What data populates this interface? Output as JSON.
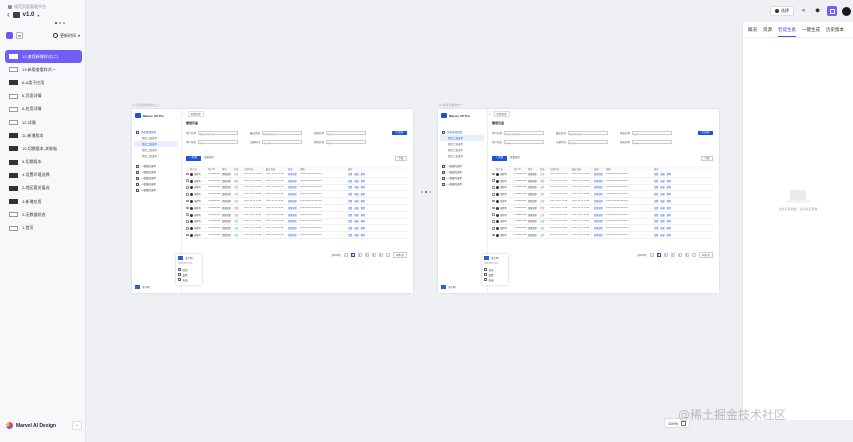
{
  "breadcrumb": "规范页面管理平台",
  "version": "v1.0",
  "left_panel": {
    "sort_label": "更新时间",
    "grid_icon_label": "88",
    "pages": [
      {
        "label": "13-查找新增样式(二)",
        "active": true,
        "thumb": "light"
      },
      {
        "label": "13-新版查看样式一",
        "active": false,
        "thumb": "light"
      },
      {
        "label": "6-A类子应用",
        "active": false,
        "thumb": "dark"
      },
      {
        "label": "6-页面详情",
        "active": false,
        "thumb": "light"
      },
      {
        "label": "6-应用详情",
        "active": false,
        "thumb": "light"
      },
      {
        "label": "12-详情",
        "active": false,
        "thumb": "light"
      },
      {
        "label": "11-新增版本",
        "active": false,
        "thumb": "dark"
      },
      {
        "label": "10-切换版本-关联板",
        "active": false,
        "thumb": "dark"
      },
      {
        "label": "9-切换版本",
        "active": false,
        "thumb": "dark"
      },
      {
        "label": "4-设置环境选择",
        "active": false,
        "thumb": "dark"
      },
      {
        "label": "2-地区要关值选",
        "active": false,
        "thumb": "dark"
      },
      {
        "label": "3-新增应用",
        "active": false,
        "thumb": "dark"
      },
      {
        "label": "2-无数据状态",
        "active": false,
        "thumb": "light"
      },
      {
        "label": "1-首页",
        "active": false,
        "thumb": "light"
      }
    ],
    "brand": "Marvel AI Design"
  },
  "toolbar": {
    "select_label": "选择",
    "active_color": "#6f5ff5"
  },
  "right_panel": {
    "tabs": [
      {
        "label": "概况",
        "active": false
      },
      {
        "label": "资源",
        "active": false
      },
      {
        "label": "智能生素",
        "active": true
      },
      {
        "label": "一键生成",
        "active": false
      },
      {
        "label": "历史版本",
        "active": false
      }
    ],
    "empty_text": "当前没有数据，请生成后查看"
  },
  "frames": [
    {
      "label": "13-查找新增样式(二)",
      "logo": "Marvel_UP Pro",
      "tab": "管理管理",
      "title": "管理页面",
      "nav": [
        {
          "label": "系统管理页面",
          "kind": "group"
        },
        {
          "label": "我的二级菜单",
          "kind": "sub"
        },
        {
          "label": "我的二级菜单",
          "kind": "sub",
          "selected": true
        },
        {
          "label": "我的二级菜单",
          "kind": "sub"
        },
        {
          "label": "我的二级菜单",
          "kind": "sub"
        },
        {
          "label": "一级级的菜单",
          "kind": "top"
        },
        {
          "label": "一级级的菜单",
          "kind": "top"
        },
        {
          "label": "一级级的菜单",
          "kind": "top"
        },
        {
          "label": "一级级的菜单",
          "kind": "top"
        },
        {
          "label": "一级级的菜单",
          "kind": "top"
        }
      ],
      "user": "王小明"
    },
    {
      "label": "13-新版查看样式一",
      "logo": "Marvel_UP Pro",
      "tab": "管理管理",
      "title": "管理页面",
      "nav": [
        {
          "label": "系统管理页面",
          "kind": "group"
        },
        {
          "label": "我的二级菜单",
          "kind": "sub",
          "selected": true
        },
        {
          "label": "我的二级菜单",
          "kind": "sub"
        },
        {
          "label": "我的二级菜单",
          "kind": "sub"
        },
        {
          "label": "我的二级菜单",
          "kind": "sub"
        },
        {
          "label": "一级级的菜单",
          "kind": "top"
        },
        {
          "label": "一级级的菜单",
          "kind": "top"
        },
        {
          "label": "一级级的菜单",
          "kind": "top"
        },
        {
          "label": "一级级的菜单",
          "kind": "top"
        }
      ],
      "user": "王小明"
    }
  ],
  "frame_ui": {
    "filters": [
      {
        "label": "用户名称",
        "placeholder": "请输入用户名"
      },
      {
        "label": "最近登录",
        "placeholder": "请选择时间"
      },
      {
        "label": "角色名称",
        "placeholder": "全部"
      },
      {
        "label": "用户状态",
        "placeholder": "全部"
      },
      {
        "label": "注册时间",
        "placeholder": "请选择"
      },
      {
        "label": "角色名称",
        "placeholder": "全部"
      }
    ],
    "query_btn": "Q 查询",
    "add_btn": "+ 新增",
    "batch_btn": "批量操作",
    "download_btn": "下载",
    "columns": [
      "",
      "用户名",
      "用户ID",
      "角色",
      "状态",
      "注册时间",
      "最近登录",
      "描述",
      "邮箱",
      "操作"
    ],
    "rows": [
      {
        "name": "张晓明",
        "id": "1234567890",
        "role": "超级管理",
        "status": "正常",
        "st": "gr",
        "date": "2022-12-12 12:00",
        "desc": "XXXXXXXXXXXXXXX"
      },
      {
        "name": "张晓明",
        "id": "1234567890",
        "role": "超级管理",
        "status": "禁用",
        "st": "rd",
        "date": "2022-12-12 12:00",
        "desc": "XXXXXXXXXXXXXXX"
      },
      {
        "name": "张晓明",
        "id": "1234567890",
        "role": "超级管理",
        "status": "正常",
        "st": "gr",
        "date": "2022-12-12 12:00",
        "desc": "XXXXXXXXXXXXXXX"
      },
      {
        "name": "张晓明",
        "id": "1234567890",
        "role": "超级管理",
        "status": "正常",
        "st": "gr",
        "date": "2022-12-12 12:00",
        "desc": "XXXXXXXXXXXXXXX"
      },
      {
        "name": "张晓明",
        "id": "1234567890",
        "role": "超级管理",
        "status": "正常",
        "st": "gr",
        "date": "2022-12-12 12:00",
        "desc": "XXXXXXXXXXXXXXX"
      },
      {
        "name": "张晓明",
        "id": "1234567890",
        "role": "超级管理",
        "status": "禁用",
        "st": "rd",
        "date": "2022-12-12 12:00",
        "desc": "XXXXXXXXXXXXXXX"
      },
      {
        "name": "张晓明",
        "id": "1234567890",
        "role": "超级管理",
        "status": "正常",
        "st": "gr",
        "date": "2022-12-12 12:00",
        "desc": "XXXXXXXXXXXXXXX"
      },
      {
        "name": "张晓明",
        "id": "1234567890",
        "role": "超级管理",
        "status": "正常",
        "st": "gr",
        "date": "2022-12-12 12:00",
        "desc": "XXXXXXXXXXXXXXX"
      },
      {
        "name": "张晓明",
        "id": "1234567890",
        "role": "超级管理",
        "status": "正常",
        "st": "gr",
        "date": "2022-12-12 12:00",
        "desc": "XXXXXXXXXXXXXXX"
      },
      {
        "name": "张晓明",
        "id": "1234567890",
        "role": "超级管理",
        "status": "正常",
        "st": "gr",
        "date": "2022-12-12 12:00",
        "desc": "XXXXXXXXXXXXXXX"
      }
    ],
    "action_links": [
      "查看",
      "编辑",
      "删除"
    ],
    "pager_total": "共100条",
    "pager_pages": [
      "1",
      "2",
      "3",
      "4",
      "5"
    ],
    "pager_size": "10条/页",
    "popup_items": [
      "首页",
      "设置",
      "退出"
    ],
    "popup_sub": "管理员账号信息"
  },
  "zoom_label": "100%",
  "watermark": "@稀土掘金技术社区"
}
